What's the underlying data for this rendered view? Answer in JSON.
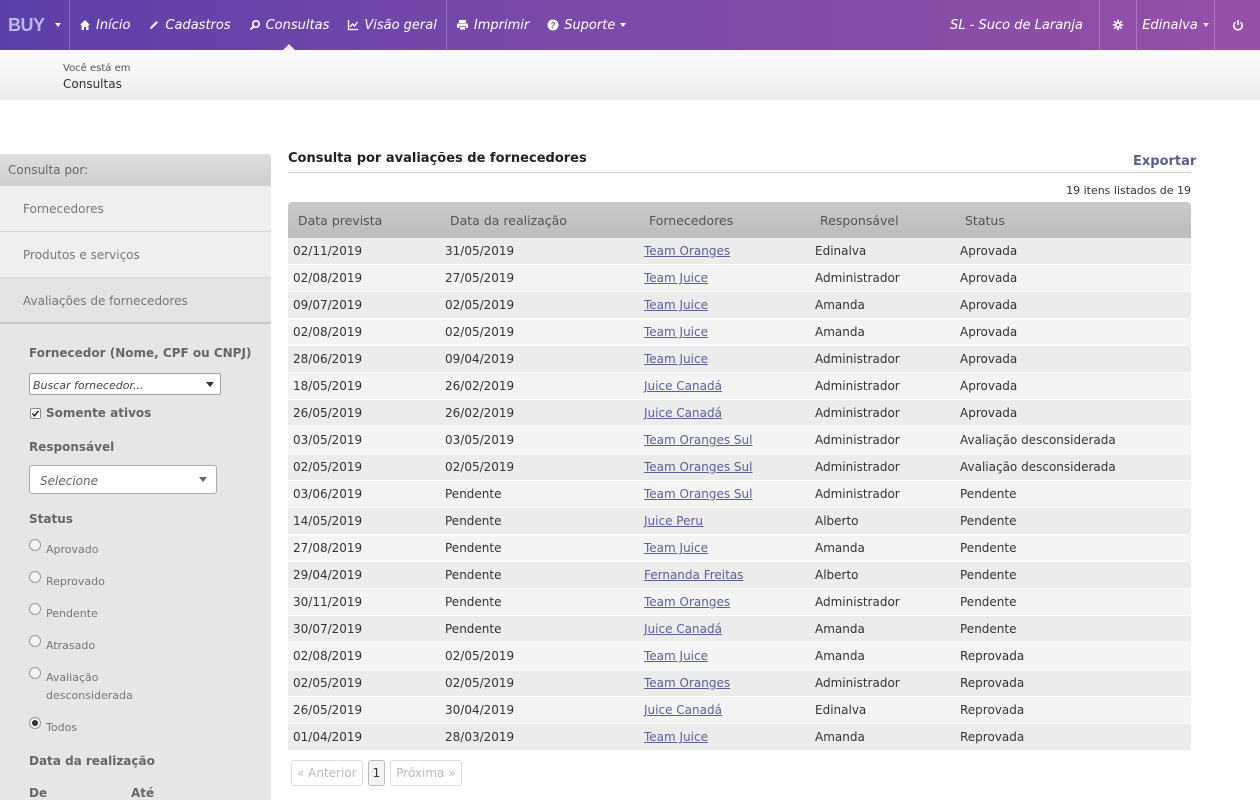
{
  "nav": {
    "logo": "BUY",
    "items": [
      {
        "label": "Início",
        "icon": "home-icon"
      },
      {
        "label": "Cadastros",
        "icon": "pencil-icon"
      },
      {
        "label": "Consultas",
        "icon": "search-icon"
      },
      {
        "label": "Visão geral",
        "icon": "chart-icon"
      },
      {
        "label": "Imprimir",
        "icon": "printer-icon"
      },
      {
        "label": "Suporte",
        "icon": "help-icon"
      }
    ],
    "company": "SL - Suco de Laranja",
    "user": "Edinalva"
  },
  "breadcrumb": {
    "label": "Você está em",
    "current": "Consultas"
  },
  "sidebar": {
    "header": "Consulta por:",
    "links": [
      "Fornecedores",
      "Produtos e serviços",
      "Avaliações de fornecedores"
    ],
    "filters": {
      "supplier_label": "Fornecedor (Nome, CPF ou CNPJ)",
      "supplier_placeholder": "Buscar fornecedor...",
      "only_active_label": "Somente ativos",
      "responsible_label": "Responsável",
      "responsible_placeholder": "Selecione",
      "status_label": "Status",
      "status_options": [
        "Aprovado",
        "Reprovado",
        "Pendente",
        "Atrasado",
        "Avaliação desconsiderada",
        "Todos"
      ],
      "status_option_lines": [
        [
          "Aprovado"
        ],
        [
          "Reprovado"
        ],
        [
          "Pendente"
        ],
        [
          "Atrasado"
        ],
        [
          "Avaliação",
          "desconsiderada"
        ],
        [
          "Todos"
        ]
      ],
      "status_selected": "Todos",
      "date_label": "Data da realização",
      "from_label": "De",
      "to_label": "Até"
    }
  },
  "main": {
    "title": "Consulta por avaliações de fornecedores",
    "export_label": "Exportar",
    "count_text": "19 itens listados de 19",
    "columns": [
      "Data prevista",
      "Data da realização",
      "Fornecedores",
      "Responsável",
      "Status"
    ],
    "rows": [
      [
        "02/11/2019",
        "31/05/2019",
        "Team Oranges",
        "Edinalva",
        "Aprovada"
      ],
      [
        "02/08/2019",
        "27/05/2019",
        "Team Juice",
        "Administrador",
        "Aprovada"
      ],
      [
        "09/07/2019",
        "02/05/2019",
        "Team Juice",
        "Amanda",
        "Aprovada"
      ],
      [
        "02/08/2019",
        "02/05/2019",
        "Team Juice",
        "Amanda",
        "Aprovada"
      ],
      [
        "28/06/2019",
        "09/04/2019",
        "Team Juice",
        "Administrador",
        "Aprovada"
      ],
      [
        "18/05/2019",
        "26/02/2019",
        "Juice Canadá",
        "Administrador",
        "Aprovada"
      ],
      [
        "26/05/2019",
        "26/02/2019",
        "Juice Canadá",
        "Administrador",
        "Aprovada"
      ],
      [
        "03/05/2019",
        "03/05/2019",
        "Team Oranges Sul",
        "Administrador",
        "Avaliação desconsiderada"
      ],
      [
        "02/05/2019",
        "02/05/2019",
        "Team Oranges Sul",
        "Administrador",
        "Avaliação desconsiderada"
      ],
      [
        "03/06/2019",
        "Pendente",
        "Team Oranges Sul",
        "Administrador",
        "Pendente"
      ],
      [
        "14/05/2019",
        "Pendente",
        "Juice Peru",
        "Alberto",
        "Pendente"
      ],
      [
        "27/08/2019",
        "Pendente",
        "Team Juice",
        "Amanda",
        "Pendente"
      ],
      [
        "29/04/2019",
        "Pendente",
        "Fernanda Freitas",
        "Alberto",
        "Pendente"
      ],
      [
        "30/11/2019",
        "Pendente",
        "Team Oranges",
        "Administrador",
        "Pendente"
      ],
      [
        "30/07/2019",
        "Pendente",
        "Juice Canadá",
        "Amanda",
        "Pendente"
      ],
      [
        "02/08/2019",
        "02/05/2019",
        "Team Juice",
        "Amanda",
        "Reprovada"
      ],
      [
        "02/05/2019",
        "02/05/2019",
        "Team Oranges",
        "Administrador",
        "Reprovada"
      ],
      [
        "26/05/2019",
        "30/04/2019",
        "Juice Canadá",
        "Edinalva",
        "Reprovada"
      ],
      [
        "01/04/2019",
        "28/03/2019",
        "Team Juice",
        "Amanda",
        "Reprovada"
      ]
    ],
    "pagination": {
      "prev": "« Anterior",
      "current": "1",
      "next": "Próxima »"
    }
  },
  "colors": {
    "nav_start": "#5d3ea8",
    "nav_end": "#9650a8",
    "link": "#5a5f9a"
  }
}
